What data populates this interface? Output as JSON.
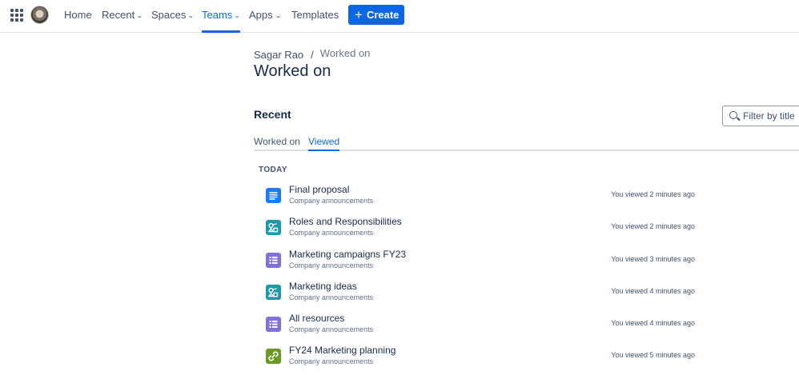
{
  "nav": {
    "items": [
      {
        "label": "Home",
        "has_chevron": false
      },
      {
        "label": "Recent",
        "has_chevron": true
      },
      {
        "label": "Spaces",
        "has_chevron": true
      },
      {
        "label": "Teams",
        "has_chevron": true,
        "active": true
      },
      {
        "label": "Apps",
        "has_chevron": true
      },
      {
        "label": "Templates",
        "has_chevron": false
      }
    ],
    "create_label": "Create",
    "accent_color": "#0c66e4"
  },
  "breadcrumb": {
    "parent": "Sagar Rao",
    "separator": "/",
    "current": "Worked on"
  },
  "page": {
    "title": "Worked on",
    "section_title": "Recent",
    "filter_placeholder": "Filter by title"
  },
  "tabs": [
    {
      "label": "Worked on",
      "active": false
    },
    {
      "label": "Viewed",
      "active": true
    }
  ],
  "group_label": "TODAY",
  "items": [
    {
      "title": "Final proposal",
      "space": "Company announcements",
      "time": "You viewed 2 minutes ago",
      "icon": "page-icon",
      "color": "#1d7afc"
    },
    {
      "title": "Roles and Responsibilities",
      "space": "Company announcements",
      "time": "You viewed 2 minutes ago",
      "icon": "whiteboard-icon",
      "color": "#1d9aaa"
    },
    {
      "title": "Marketing campaigns FY23",
      "space": "Company announcements",
      "time": "You viewed 3 minutes ago",
      "icon": "database-icon",
      "color": "#8270db"
    },
    {
      "title": "Marketing ideas",
      "space": "Company announcements",
      "time": "You viewed 4 minutes ago",
      "icon": "whiteboard-icon",
      "color": "#1d9aaa"
    },
    {
      "title": "All resources",
      "space": "Company announcements",
      "time": "You viewed 4 minutes ago",
      "icon": "database-icon",
      "color": "#8270db"
    },
    {
      "title": "FY24 Marketing planning",
      "space": "Company announcements",
      "time": "You viewed 5 minutes ago",
      "icon": "smart-link-icon",
      "color": "#6a9a23"
    }
  ]
}
